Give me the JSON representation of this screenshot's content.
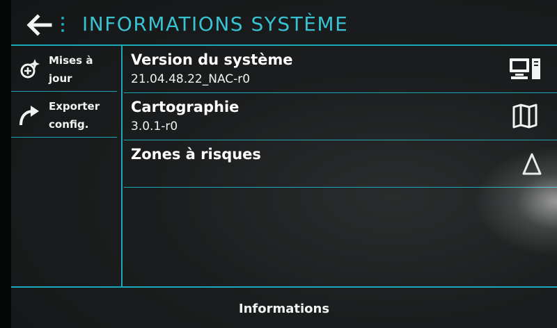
{
  "header": {
    "title": "INFORMATIONS SYSTÈME",
    "back_icon": "arrow-left-icon",
    "menu_icon": "vertical-dots-icon"
  },
  "sidebar": {
    "items": [
      {
        "label_line1": "Mises à",
        "label_line2": "jour",
        "icon": "update-gear-icon"
      },
      {
        "label_line1": "Exporter",
        "label_line2": "config.",
        "icon": "export-arrow-icon"
      }
    ]
  },
  "main": {
    "rows": [
      {
        "title": "Version du système",
        "value": "21.04.48.22_NAC-r0",
        "icon": "computer-icon"
      },
      {
        "title": "Cartographie",
        "value": "3.0.1-r0",
        "icon": "map-icon"
      },
      {
        "title": "Zones à risques",
        "value": "",
        "icon": "warning-triangle-icon"
      }
    ]
  },
  "footer": {
    "label": "Informations"
  },
  "colors": {
    "accent": "#1aa9b8",
    "title": "#37c3d1",
    "background": "#1b1d1e",
    "text": "#f2f4f4"
  }
}
